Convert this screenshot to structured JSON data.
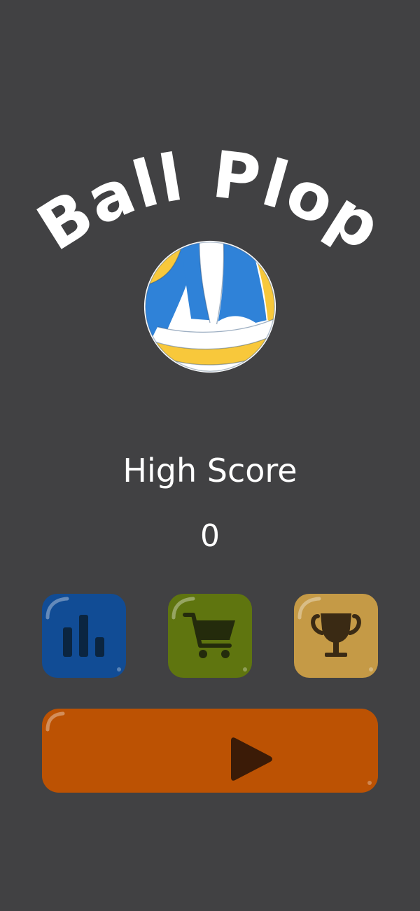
{
  "game": {
    "title": "Ball Plop"
  },
  "score": {
    "label": "High Score",
    "value": "0"
  },
  "buttons": {
    "leaderboard": {
      "icon": "bar-chart-icon",
      "color": "#114c95"
    },
    "shop": {
      "icon": "shopping-cart-icon",
      "color": "#5f750f"
    },
    "achievements": {
      "icon": "trophy-icon",
      "color": "#c59a46"
    },
    "play": {
      "icon": "play-icon",
      "color": "#bc5203"
    }
  },
  "colors": {
    "background": "#414143",
    "ball_blue": "#2f82d8",
    "ball_yellow": "#f8c83b",
    "ball_white": "#ffffff"
  }
}
